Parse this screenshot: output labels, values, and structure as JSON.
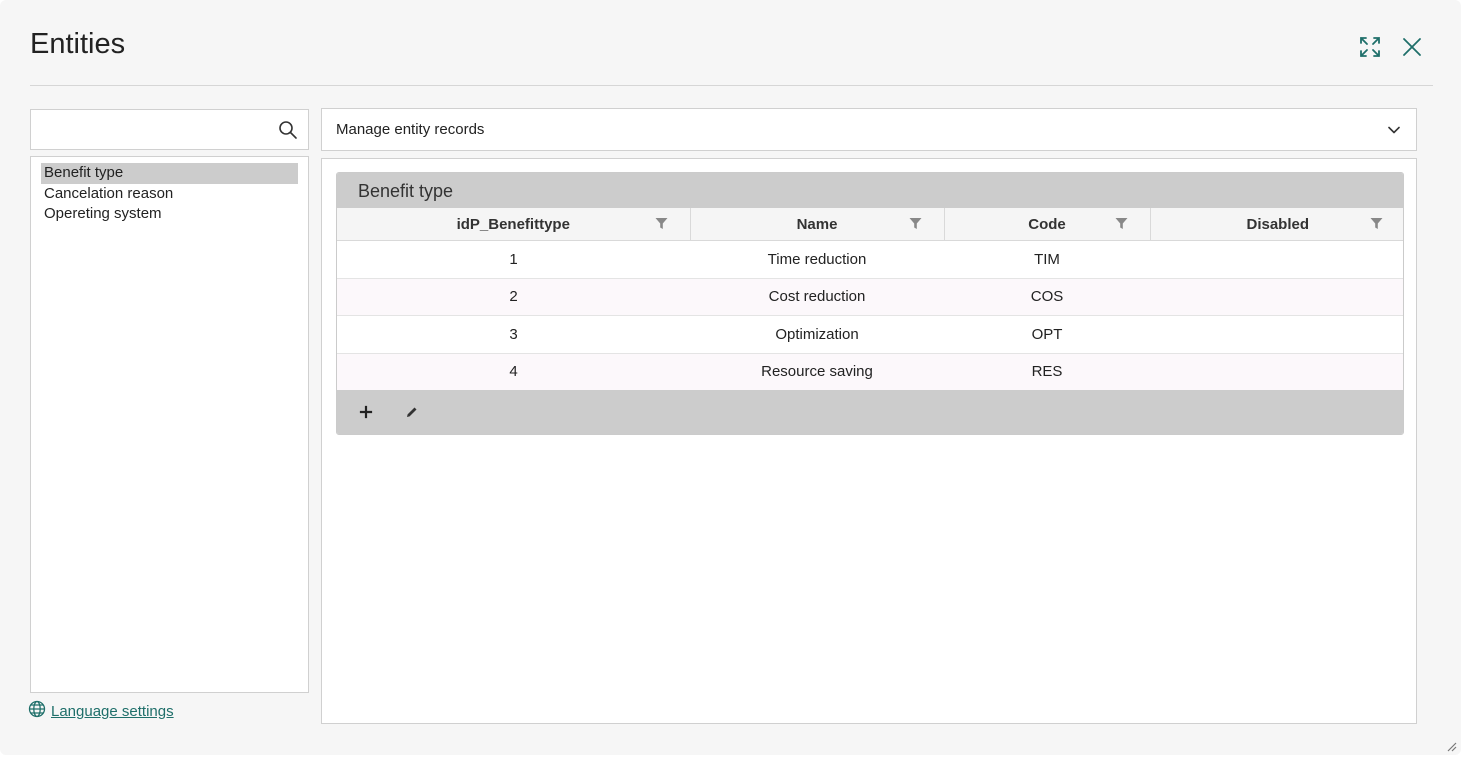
{
  "dialog": {
    "title": "Entities",
    "maximize_icon": "maximize-icon",
    "close_icon": "close-icon"
  },
  "sidebar": {
    "search": {
      "value": "",
      "placeholder": "",
      "icon": "search-icon"
    },
    "items": [
      {
        "label": "Benefit type",
        "selected": true
      },
      {
        "label": "Cancelation reason",
        "selected": false
      },
      {
        "label": "Opereting system",
        "selected": false
      }
    ],
    "language_link": {
      "label": "Language settings",
      "icon": "globe-icon"
    }
  },
  "main": {
    "select": {
      "label": "Manage entity records",
      "icon": "chevron-down-icon"
    },
    "grid": {
      "caption": "Benefit type",
      "columns": [
        "idP_Benefittype",
        "Name",
        "Code",
        "Disabled"
      ],
      "rows": [
        [
          "1",
          "Time reduction",
          "TIM",
          ""
        ],
        [
          "2",
          "Cost reduction",
          "COS",
          ""
        ],
        [
          "3",
          "Optimization",
          "OPT",
          ""
        ],
        [
          "4",
          "Resource saving",
          "RES",
          ""
        ]
      ],
      "footer": {
        "add_icon": "plus-icon",
        "edit_icon": "pencil-icon"
      }
    }
  },
  "colors": {
    "accent": "#1f6f6a",
    "header_bar": "#cccccc",
    "alt_row": "#fcf8fb"
  }
}
